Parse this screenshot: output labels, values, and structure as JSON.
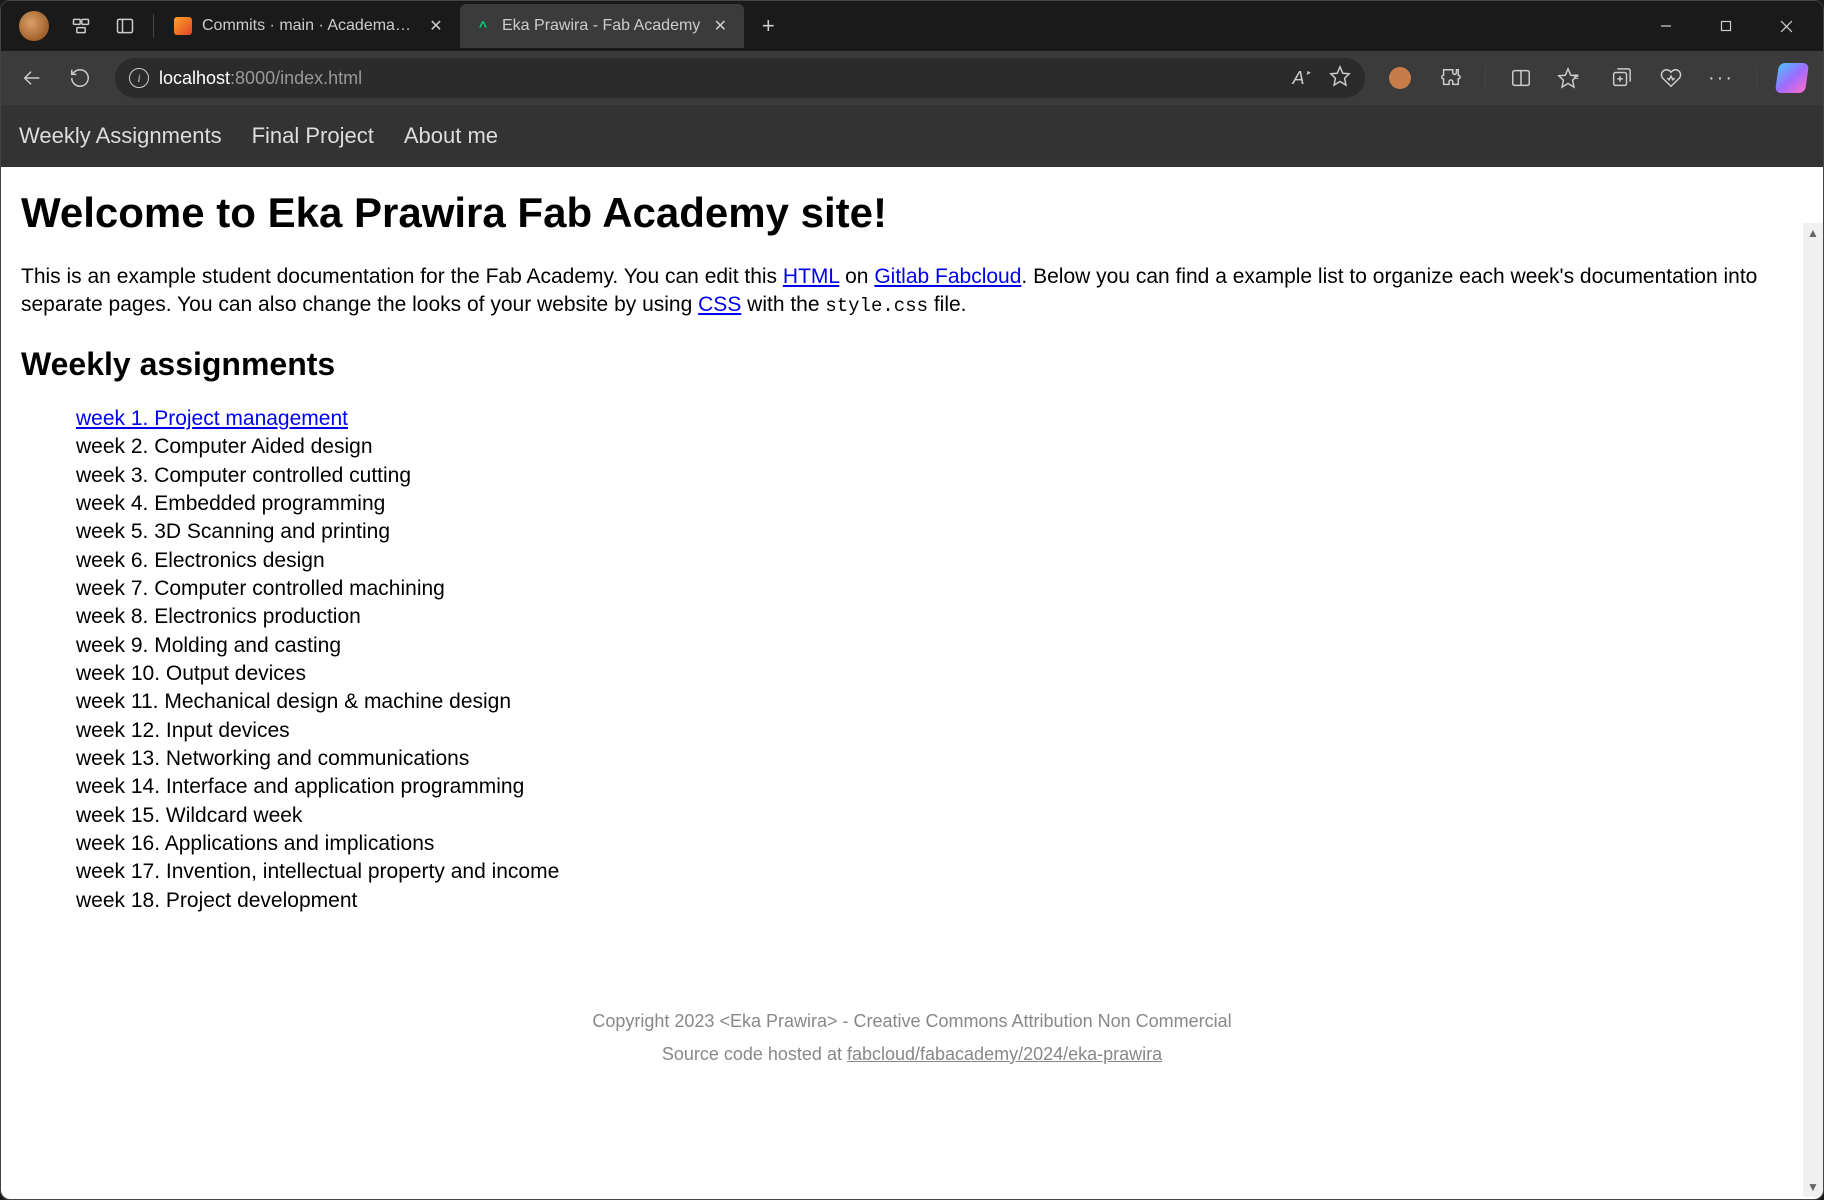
{
  "browser": {
    "tabs": [
      {
        "title": "Commits · main · Academany / Fa",
        "active": false
      },
      {
        "title": "Eka Prawira - Fab Academy",
        "active": true
      }
    ],
    "url_host": "localhost",
    "url_port_path": ":8000/index.html"
  },
  "nav": {
    "items": [
      "Weekly Assignments",
      "Final Project",
      "About me"
    ]
  },
  "page": {
    "heading": "Welcome to Eka Prawira Fab Academy site!",
    "intro_1": "This is an example student documentation for the Fab Academy. You can edit this ",
    "link_html": "HTML",
    "intro_2": " on ",
    "link_gitlab": "Gitlab Fabcloud",
    "intro_3": ". Below you can find a example list to organize each week's documentation into separate pages. You can also change the looks of your website by using ",
    "link_css": "CSS",
    "intro_4": " with the ",
    "code_file": "style.css",
    "intro_5": " file.",
    "subheading": "Weekly assignments",
    "weeks": [
      {
        "label": "week 1. Project management",
        "link": true
      },
      {
        "label": "week 2. Computer Aided design",
        "link": false
      },
      {
        "label": "week 3. Computer controlled cutting",
        "link": false
      },
      {
        "label": "week 4. Embedded programming",
        "link": false
      },
      {
        "label": "week 5. 3D Scanning and printing",
        "link": false
      },
      {
        "label": "week 6. Electronics design",
        "link": false
      },
      {
        "label": "week 7. Computer controlled machining",
        "link": false
      },
      {
        "label": "week 8. Electronics production",
        "link": false
      },
      {
        "label": "week 9. Molding and casting",
        "link": false
      },
      {
        "label": "week 10. Output devices",
        "link": false
      },
      {
        "label": "week 11. Mechanical design & machine design",
        "link": false
      },
      {
        "label": "week 12. Input devices",
        "link": false
      },
      {
        "label": "week 13. Networking and communications",
        "link": false
      },
      {
        "label": "week 14. Interface and application programming",
        "link": false
      },
      {
        "label": "week 15. Wildcard week",
        "link": false
      },
      {
        "label": "week 16. Applications and implications",
        "link": false
      },
      {
        "label": "week 17. Invention, intellectual property and income",
        "link": false
      },
      {
        "label": "week 18. Project development",
        "link": false
      }
    ]
  },
  "footer": {
    "copyright": "Copyright 2023 <Eka Prawira> - Creative Commons Attribution Non Commercial",
    "source_prefix": "Source code hosted at ",
    "source_link": "fabcloud/fabacademy/2024/eka-prawira"
  }
}
